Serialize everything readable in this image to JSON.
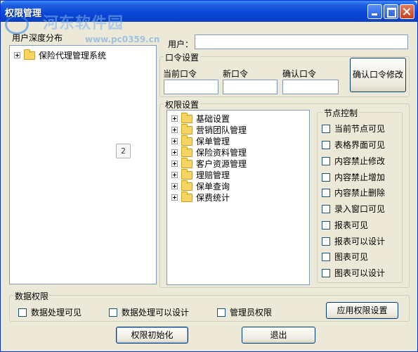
{
  "window": {
    "title": "权限管理"
  },
  "watermark": {
    "text": "河东软件园",
    "url": "www.pc0359.cn"
  },
  "tree": {
    "label": "用户深度分布",
    "items": [
      {
        "label": "保险代理管理系统"
      }
    ]
  },
  "user": {
    "label": "用户：",
    "value": ""
  },
  "password": {
    "group_title": "口令设置",
    "current_label": "当前口令",
    "new_label": "新口令",
    "confirm_label": "确认口令",
    "current_value": "",
    "new_value": "",
    "confirm_value": "",
    "confirm_button": "确认口令修改"
  },
  "permissions": {
    "group_title": "权限设置",
    "items": [
      {
        "label": "基础设置"
      },
      {
        "label": "营销团队管理"
      },
      {
        "label": "保单管理"
      },
      {
        "label": "保险资料管理"
      },
      {
        "label": "客户资源管理"
      },
      {
        "label": "理赔管理"
      },
      {
        "label": "保单查询"
      },
      {
        "label": "保费统计"
      }
    ]
  },
  "node_control": {
    "group_title": "节点控制",
    "items": [
      {
        "label": "当前节点可见",
        "checked": false
      },
      {
        "label": "表格界面可见",
        "checked": false
      },
      {
        "label": "内容禁止修改",
        "checked": false
      },
      {
        "label": "内容禁止增加",
        "checked": false
      },
      {
        "label": "内容禁止删除",
        "checked": false
      },
      {
        "label": "录入窗口可见",
        "checked": false
      },
      {
        "label": "报表可见",
        "checked": false
      },
      {
        "label": "报表可以设计",
        "checked": false
      },
      {
        "label": "图表可见",
        "checked": false
      },
      {
        "label": "图表可以设计",
        "checked": false
      }
    ]
  },
  "data_perms": {
    "group_title": "数据权限",
    "items": [
      {
        "label": "数据处理可见",
        "checked": false
      },
      {
        "label": "数据处理可以设计",
        "checked": false
      },
      {
        "label": "管理员权限",
        "checked": false
      }
    ],
    "apply_button": "应用权限设置"
  },
  "footer": {
    "init_button": "权限初始化",
    "exit_button": "退出"
  },
  "badge": {
    "text": "2"
  },
  "colors": {
    "title_bar": "#0a46d6",
    "window_bg": "#ece9d8",
    "folder": "#f7d560"
  }
}
